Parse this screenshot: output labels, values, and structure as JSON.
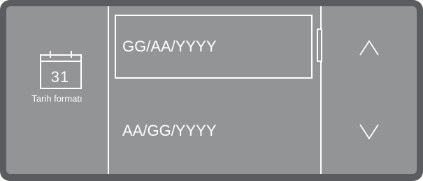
{
  "setting": {
    "icon": "calendar-icon",
    "calendar_day": "31",
    "caption": "Tarih formatı"
  },
  "options": [
    {
      "label": "GG/AA/YYYY",
      "selected": true
    },
    {
      "label": "AA/GG/YYYY",
      "selected": false
    }
  ],
  "navigation": {
    "up_icon": "chevron-up-icon",
    "down_icon": "chevron-down-icon"
  },
  "colors": {
    "frame": "#5b5c5f",
    "screen": "#939496",
    "foreground": "#ffffff"
  }
}
